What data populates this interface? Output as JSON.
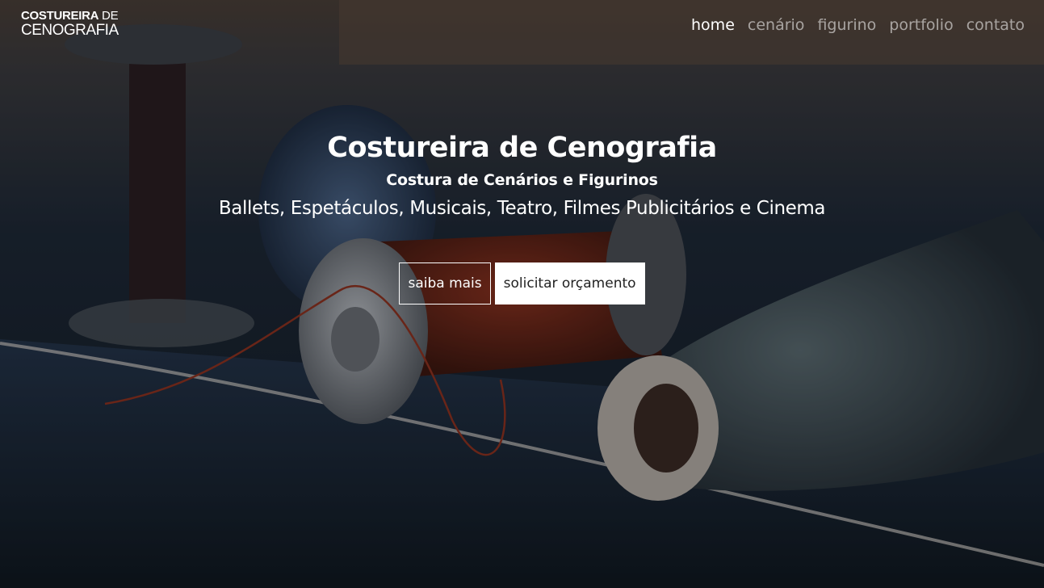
{
  "logo": {
    "line1_bold": "COSTUREIRA",
    "line1_light": "DE",
    "line2": "CENOGRAFIA"
  },
  "nav": {
    "items": [
      {
        "label": "home",
        "active": true
      },
      {
        "label": "cenário",
        "active": false
      },
      {
        "label": "figurino",
        "active": false
      },
      {
        "label": "portfolio",
        "active": false
      },
      {
        "label": "contato",
        "active": false
      }
    ]
  },
  "hero": {
    "title": "Costureira de Cenografia",
    "subtitle": "Costura de Cenários e Figurinos",
    "tagline": "Ballets, Espetáculos, Musicais, Teatro, Filmes Publicitários e Cinema",
    "primary_button": "saiba mais",
    "secondary_button": "solicitar orçamento",
    "background_image": "thread-spools-on-fabric"
  },
  "colors": {
    "text": "#ffffff",
    "nav_inactive": "#a8aeb6",
    "button_solid_bg": "#ffffff",
    "button_solid_text": "#222222"
  }
}
